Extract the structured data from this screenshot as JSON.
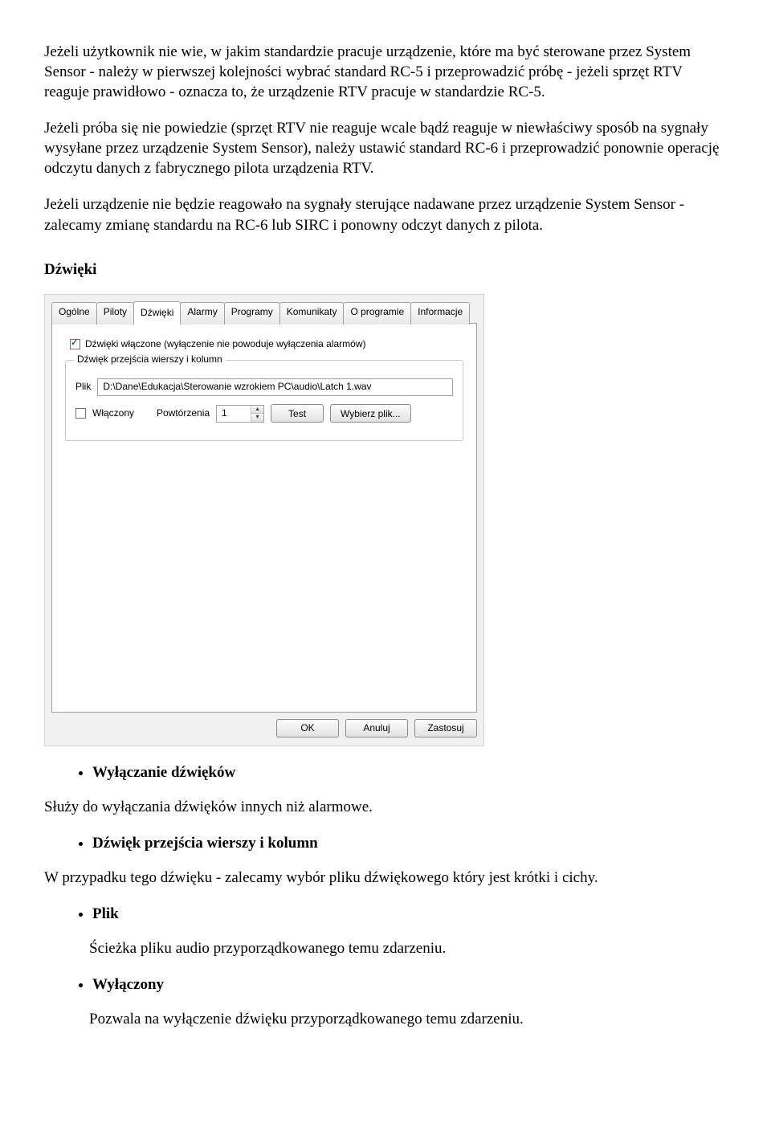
{
  "paragraphs": {
    "p1": "Jeżeli użytkownik nie wie, w jakim standardzie pracuje urządzenie, które ma być sterowane przez System Sensor - należy w pierwszej kolejności wybrać standard RC-5 i przeprowadzić próbę - jeżeli sprzęt RTV reaguje prawidłowo - oznacza to, że urządzenie RTV pracuje w standardzie RC-5.",
    "p2": "Jeżeli próba się nie powiedzie (sprzęt RTV nie reaguje wcale bądź reaguje w niewłaściwy sposób na sygnały wysyłane przez urządzenie System Sensor), należy ustawić standard RC-6 i przeprowadzić ponownie operację odczytu danych z fabrycznego pilota urządzenia RTV.",
    "p3": "Jeżeli urządzenie nie będzie reagowało na sygnały sterujące nadawane przez urządzenie System Sensor - zalecamy zmianę standardu na RC-6 lub SIRC i ponowny odczyt danych z pilota."
  },
  "section_head": "Dźwięki",
  "dialog": {
    "tabs": [
      "Ogólne",
      "Piloty",
      "Dźwięki",
      "Alarmy",
      "Programy",
      "Komunikaty",
      "O programie",
      "Informacje"
    ],
    "active_tab_index": 2,
    "sounds_on_label": "Dźwięki włączone (wyłączenie nie powoduje wyłączenia alarmów)",
    "group": {
      "legend": "Dźwięk przejścia wierszy i kolumn",
      "file_label": "Plik",
      "file_value": "D:\\Dane\\Edukacja\\Sterowanie wzrokiem PC\\audio\\Latch 1.wav",
      "enabled_label": "Włączony",
      "repeat_label": "Powtórzenia",
      "repeat_value": "1",
      "test_label": "Test",
      "choose_label": "Wybierz plik..."
    },
    "buttons": {
      "ok": "OK",
      "cancel": "Anuluj",
      "apply": "Zastosuj"
    }
  },
  "list1": {
    "item1": "Wyłączanie dźwięków",
    "after1": "Służy do wyłączania dźwięków innych niż alarmowe.",
    "item2": "Dźwięk przejścia wierszy i kolumn",
    "after2": "W przypadku tego dźwięku - zalecamy wybór pliku dźwiękowego który jest krótki i cichy.",
    "item3": "Plik",
    "after3": "Ścieżka pliku audio przyporządkowanego temu zdarzeniu.",
    "item4": "Wyłączony",
    "after4": "Pozwala na wyłączenie dźwięku przyporządkowanego temu zdarzeniu."
  }
}
